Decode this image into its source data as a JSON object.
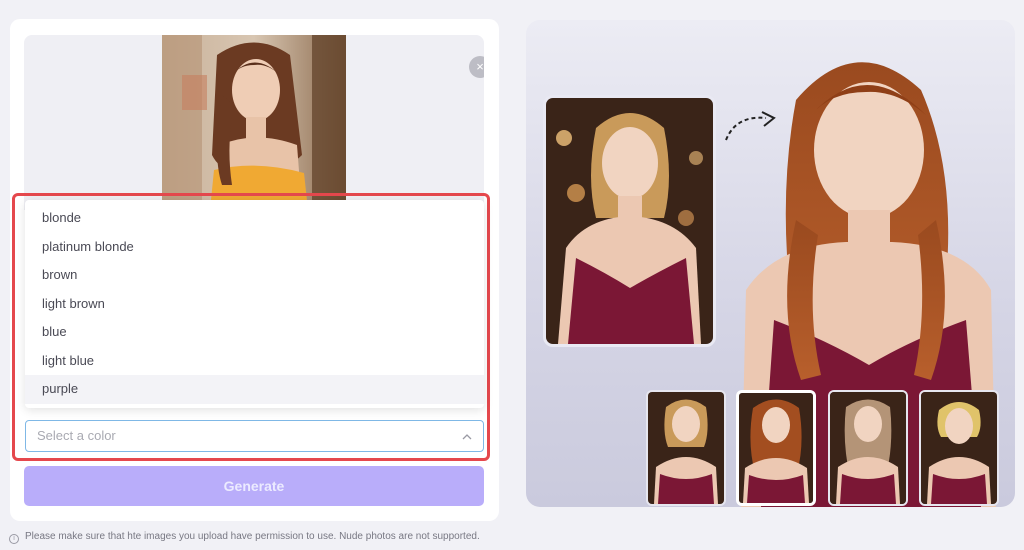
{
  "upload": {
    "close_label": "×"
  },
  "color_dropdown": {
    "options": [
      "blonde",
      "platinum blonde",
      "brown",
      "light brown",
      "blue",
      "light blue",
      "purple"
    ],
    "highlighted_option": "purple",
    "placeholder": "Select a color"
  },
  "generate": {
    "label": "Generate"
  },
  "disclaimer": {
    "icon": "info-icon",
    "text": "Please make sure that hte images you upload have permission to use. Nude photos are not supported."
  },
  "showcase": {
    "arrow_icon": "curved-dashed-arrow-icon",
    "thumbnail_count": 4,
    "selected_thumbnail_index": 1
  },
  "colors": {
    "generate_button": "#b9adfa",
    "highlight_border": "#e5484d",
    "select_border": "#7fb8e6"
  }
}
